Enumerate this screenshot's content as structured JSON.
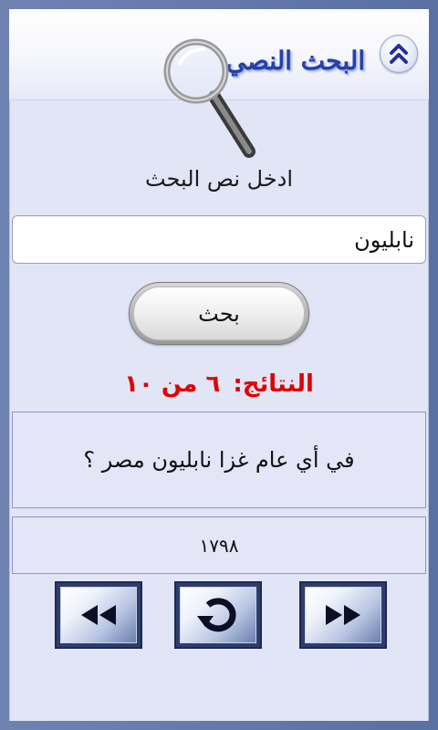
{
  "header": {
    "title": "البحث النصي",
    "logo_icon": "magnifier-icon",
    "collapse_icon": "chevron-up-icon"
  },
  "search": {
    "prompt_label": "ادخل نص البحث",
    "input_value": "نابليون",
    "button_label": "بحث"
  },
  "results": {
    "label": "النتائج:",
    "count_text": "٦ من ١٠",
    "current": 6,
    "total": 10
  },
  "result_item": {
    "question": "في أي عام غزا نابليون مصر ؟",
    "answer": "١٧٩٨"
  },
  "navigation": {
    "prev_icon": "rewind-icon",
    "reset_icon": "refresh-icon",
    "next_icon": "fast-forward-icon"
  },
  "colors": {
    "accent": "#2540a8",
    "results": "#e00000",
    "panel_background": "#e2e5f6",
    "nav_button_border": "#2d3e6e"
  }
}
